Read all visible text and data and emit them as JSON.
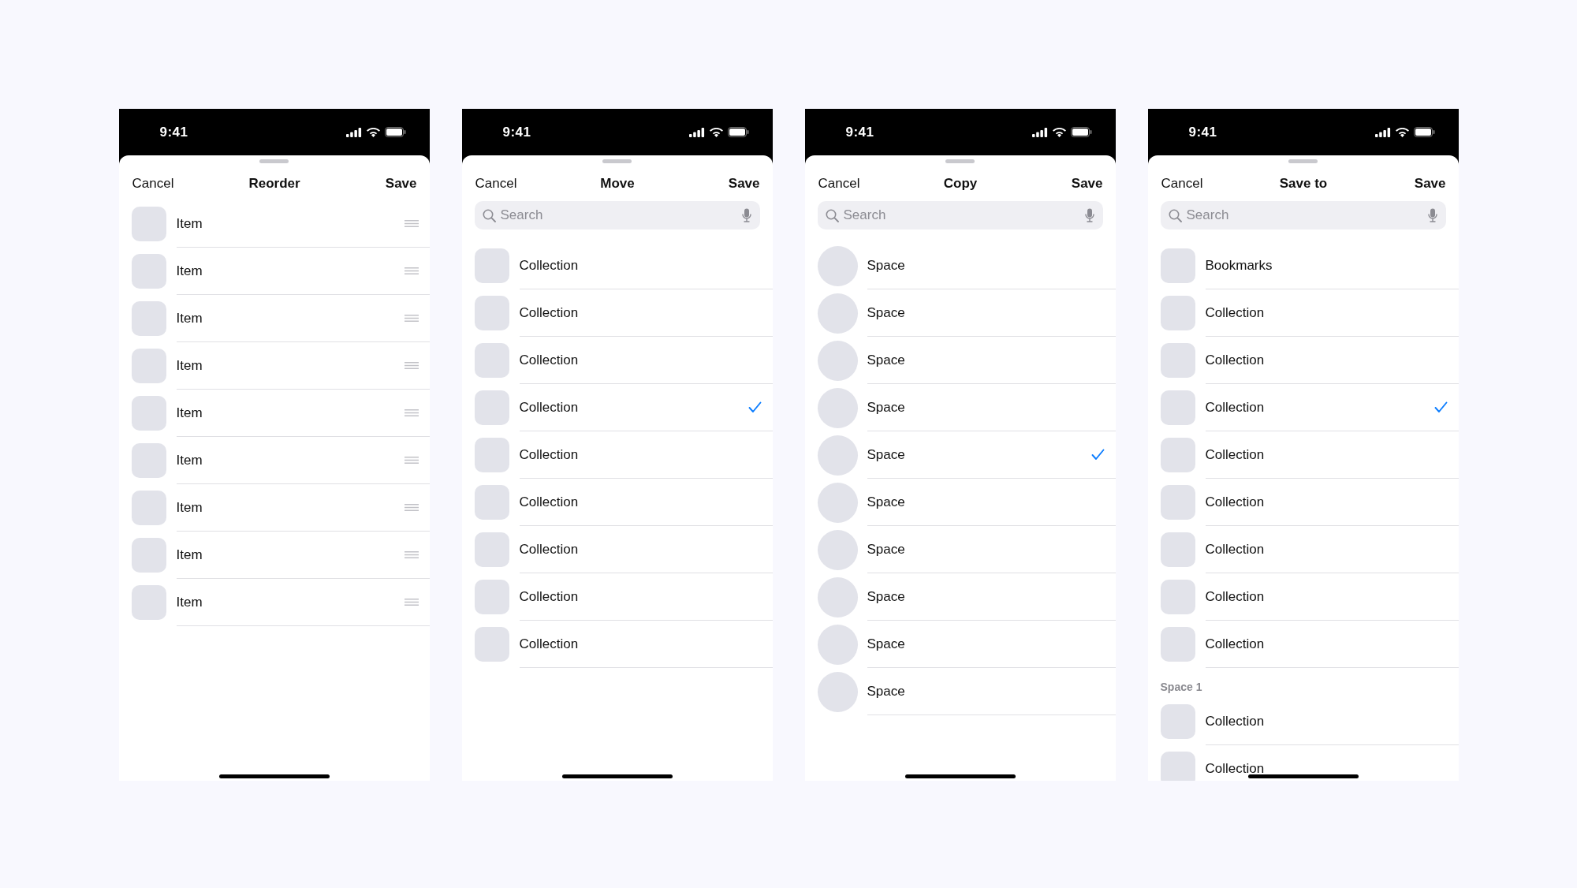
{
  "screens": [
    {
      "kind": "reorder",
      "time": "9:41",
      "cancel": "Cancel",
      "title": "Reorder",
      "save": "Save",
      "rows": [
        {
          "kind": "square",
          "label": "Item"
        },
        {
          "kind": "square",
          "label": "Item"
        },
        {
          "kind": "square",
          "label": "Item"
        },
        {
          "kind": "square",
          "label": "Item"
        },
        {
          "kind": "square",
          "label": "Item"
        },
        {
          "kind": "square",
          "label": "Item"
        },
        {
          "kind": "square",
          "label": "Item"
        },
        {
          "kind": "square",
          "label": "Item"
        },
        {
          "kind": "square",
          "label": "Item"
        }
      ]
    },
    {
      "kind": "picker",
      "time": "9:41",
      "cancel": "Cancel",
      "title": "Move",
      "save": "Save",
      "search": {
        "placeholder": "Search"
      },
      "rows": [
        {
          "kind": "square",
          "label": "Collection",
          "selected": false
        },
        {
          "kind": "square",
          "label": "Collection",
          "selected": false
        },
        {
          "kind": "square",
          "label": "Collection",
          "selected": false
        },
        {
          "kind": "square",
          "label": "Collection",
          "selected": true
        },
        {
          "kind": "square",
          "label": "Collection",
          "selected": false
        },
        {
          "kind": "square",
          "label": "Collection",
          "selected": false
        },
        {
          "kind": "square",
          "label": "Collection",
          "selected": false
        },
        {
          "kind": "square",
          "label": "Collection",
          "selected": false
        },
        {
          "kind": "square",
          "label": "Collection",
          "selected": false
        }
      ]
    },
    {
      "kind": "picker",
      "time": "9:41",
      "cancel": "Cancel",
      "title": "Copy",
      "save": "Save",
      "search": {
        "placeholder": "Search"
      },
      "rows": [
        {
          "kind": "circle",
          "label": "Space",
          "selected": false
        },
        {
          "kind": "circle",
          "label": "Space",
          "selected": false
        },
        {
          "kind": "circle",
          "label": "Space",
          "selected": false
        },
        {
          "kind": "circle",
          "label": "Space",
          "selected": false
        },
        {
          "kind": "circle",
          "label": "Space",
          "selected": true
        },
        {
          "kind": "circle",
          "label": "Space",
          "selected": false
        },
        {
          "kind": "circle",
          "label": "Space",
          "selected": false
        },
        {
          "kind": "circle",
          "label": "Space",
          "selected": false
        },
        {
          "kind": "circle",
          "label": "Space",
          "selected": false
        },
        {
          "kind": "circle",
          "label": "Space",
          "selected": false
        }
      ]
    },
    {
      "kind": "picker",
      "time": "9:41",
      "cancel": "Cancel",
      "title": "Save to",
      "save": "Save",
      "search": {
        "placeholder": "Search"
      },
      "rows": [
        {
          "kind": "square",
          "label": "Bookmarks",
          "selected": false
        },
        {
          "kind": "square",
          "label": "Collection",
          "selected": false
        },
        {
          "kind": "square",
          "label": "Collection",
          "selected": false
        },
        {
          "kind": "square",
          "label": "Collection",
          "selected": true
        },
        {
          "kind": "square",
          "label": "Collection",
          "selected": false
        },
        {
          "kind": "square",
          "label": "Collection",
          "selected": false
        },
        {
          "kind": "square",
          "label": "Collection",
          "selected": false
        },
        {
          "kind": "square",
          "label": "Collection",
          "selected": false
        },
        {
          "kind": "square",
          "label": "Collection",
          "selected": false
        },
        {
          "kind": "header",
          "label": "Space 1"
        },
        {
          "kind": "square",
          "label": "Collection",
          "selected": false
        },
        {
          "kind": "square",
          "label": "Collection",
          "selected": false
        }
      ]
    }
  ]
}
